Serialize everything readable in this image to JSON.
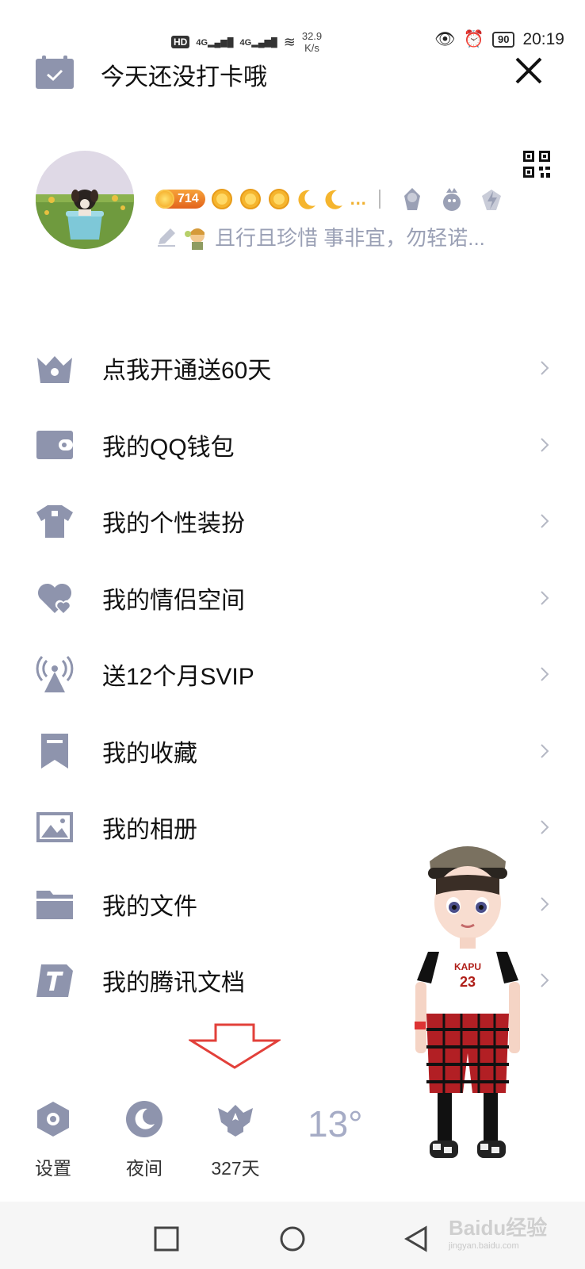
{
  "status_bar": {
    "hd": "HD",
    "signal1": "4G",
    "signal2": "4G",
    "speed_value": "32.9",
    "speed_unit": "K/s",
    "battery": "90",
    "time": "20:19"
  },
  "header": {
    "checkin_text": "今天还没打卡哦"
  },
  "profile": {
    "coin_level": "714",
    "signature": "且行且珍惜 事非宜，勿轻诺..."
  },
  "menu": {
    "items": [
      {
        "label": "点我开通送60天",
        "icon": "crown-icon"
      },
      {
        "label": "我的QQ钱包",
        "icon": "wallet-icon"
      },
      {
        "label": "我的个性装扮",
        "icon": "shirt-icon"
      },
      {
        "label": "我的情侣空间",
        "icon": "hearts-icon"
      },
      {
        "label": "送12个月SVIP",
        "icon": "broadcast-icon"
      },
      {
        "label": "我的收藏",
        "icon": "bookmark-icon"
      },
      {
        "label": "我的相册",
        "icon": "image-icon"
      },
      {
        "label": "我的文件",
        "icon": "folder-icon"
      },
      {
        "label": "我的腾讯文档",
        "icon": "doc-icon"
      }
    ]
  },
  "bottom": {
    "settings_label": "设置",
    "night_label": "夜间",
    "days_label": "327天",
    "temperature": "13°"
  },
  "figure_shirt": {
    "text": "KAPU",
    "number": "23"
  },
  "watermark": {
    "brand": "Baidu经验",
    "url": "jingyan.baidu.com"
  },
  "colors": {
    "icon_gray": "#8e94ad",
    "accent_red": "#e2403a",
    "coin_orange": "#f07d2a"
  }
}
